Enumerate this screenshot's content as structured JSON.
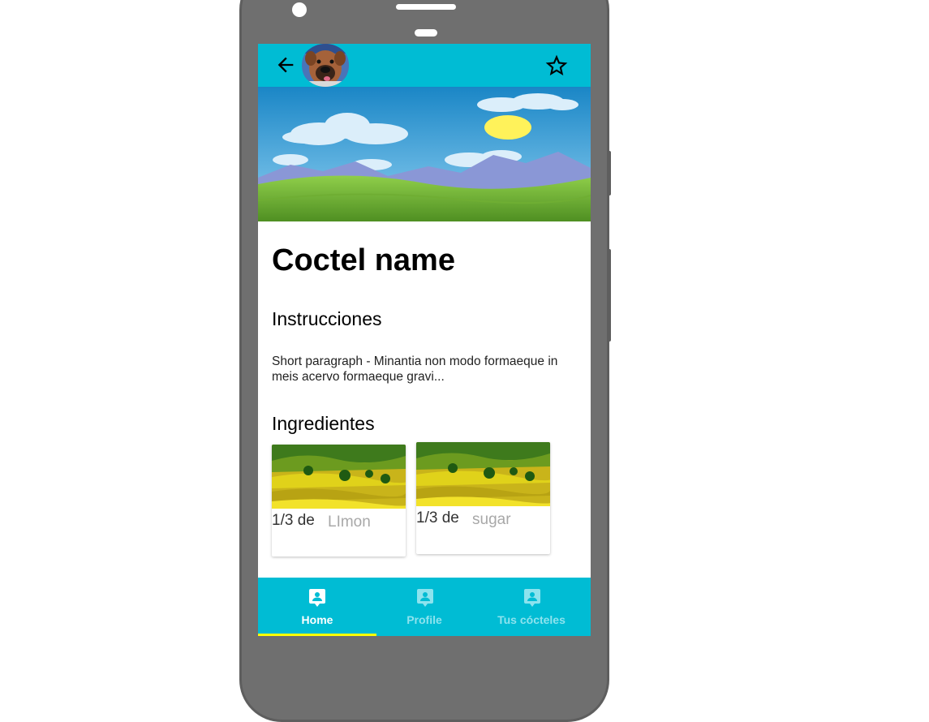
{
  "colors": {
    "primary": "#00bcd4",
    "indicator": "#ffff00",
    "inactive_tab": "#8de3ee"
  },
  "appbar": {
    "back_icon": "arrow-left-icon",
    "avatar": "dog-avatar",
    "favorite_icon": "star-outline-icon"
  },
  "cocktail": {
    "name": "Coctel name",
    "instructions_heading": "Instrucciones",
    "instructions_text": "Short paragraph - Minantia non modo formaeque in meis acervo formaeque gravi...",
    "ingredients_heading": "Ingredientes"
  },
  "ingredients": [
    {
      "quantity": "1/3 de",
      "name": "LImon"
    },
    {
      "quantity": "1/3 de",
      "name": "sugar"
    }
  ],
  "bottom_nav": {
    "tabs": [
      {
        "label": "Home",
        "icon": "contact-badge-icon",
        "active": true
      },
      {
        "label": "Profile",
        "icon": "contact-badge-icon",
        "active": false
      },
      {
        "label": "Tus cócteles",
        "icon": "contact-badge-icon",
        "active": false
      }
    ]
  }
}
